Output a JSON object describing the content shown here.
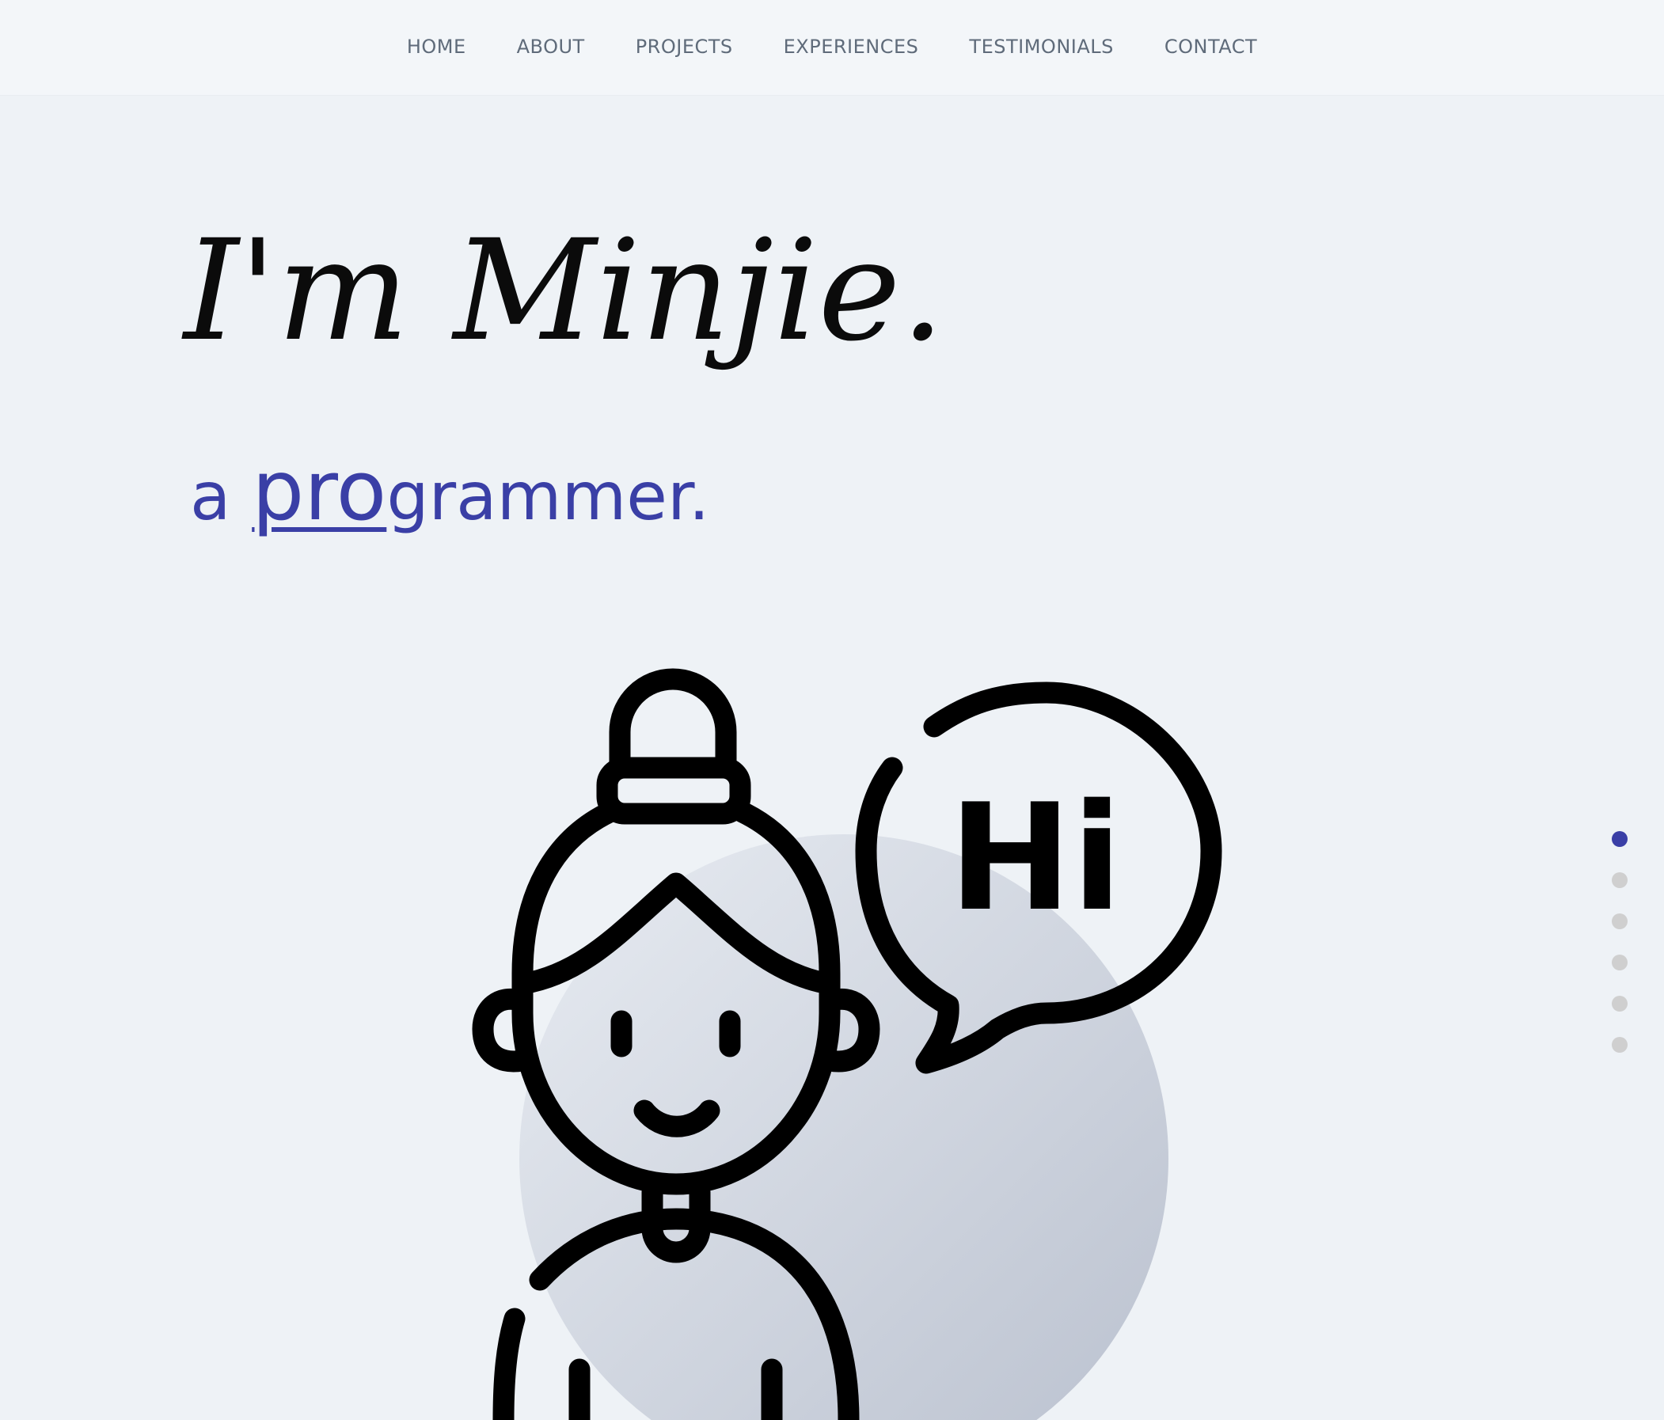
{
  "nav": {
    "items": [
      {
        "label": "HOME"
      },
      {
        "label": "ABOUT"
      },
      {
        "label": "PROJECTS"
      },
      {
        "label": "EXPERIENCES"
      },
      {
        "label": "TESTIMONIALS"
      },
      {
        "label": "CONTACT"
      }
    ]
  },
  "hero": {
    "name": "I'm Minjie.",
    "subtitle_prefix": "a ",
    "subtitle_highlight": "pro",
    "subtitle_suffix": "grammer."
  },
  "illustration": {
    "speech_text": "Hi",
    "icon": "girl-avatar-icon"
  },
  "pagination": {
    "count": 6,
    "active_index": 0
  },
  "colors": {
    "background": "#eef2f6",
    "nav_text": "#5f6b7a",
    "accent": "#3a3fa6",
    "dot_inactive": "#cfcfcf",
    "text_dark": "#0b0b0b"
  }
}
